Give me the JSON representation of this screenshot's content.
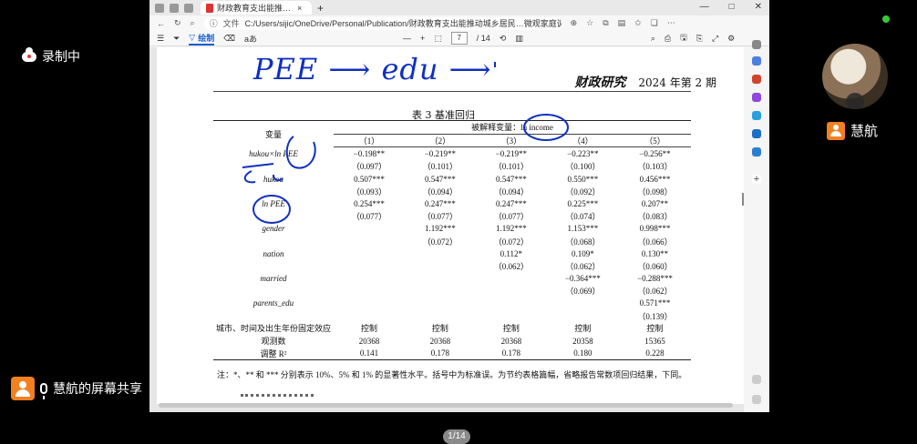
{
  "meeting": {
    "recording_label": "录制中",
    "participant_name": "慧航",
    "share_label": "慧航的屏幕共享"
  },
  "browser": {
    "tab_title": "财政教育支出能推动城乡居民人力资本…",
    "new_tab": "+",
    "address_file_label": "文件",
    "address_path": "C:/Users/sijic/OneDrive/Personal/Publication/财政教育支出能推动城乡居民…微观家庭调查数据的经验证据_贾…",
    "win_buttons": [
      "—",
      "□",
      "✕"
    ]
  },
  "pdf_toolbar": {
    "draw_label": "绘制",
    "read_aloud": "aあ",
    "zoom_minus": "—",
    "zoom_plus": "+",
    "current_page": "7",
    "total_pages": "/ 14",
    "page_badge": "1/14"
  },
  "document": {
    "handwriting": "PEE ⟶ edu ⟶",
    "journal_name": "财政研究",
    "journal_issue": "2024 年第 2 期",
    "table_title": "表 3   基准回归",
    "header_var": "变量",
    "header_dep": "被解释变量：ln income",
    "columns": [
      "（1）",
      "（2）",
      "（3）",
      "（4）",
      "（5）"
    ],
    "rows": [
      {
        "var": "hukou×ln PEE",
        "coef": [
          "−0.198**",
          "−0.219**",
          "−0.219**",
          "−0.223**",
          "−0.256**"
        ],
        "se": [
          "（0.097）",
          "（0.101）",
          "（0.101）",
          "（0.100）",
          "（0.103）"
        ]
      },
      {
        "var": "hukou",
        "coef": [
          "0.507***",
          "0.547***",
          "0.547***",
          "0.550***",
          "0.456***"
        ],
        "se": [
          "（0.093）",
          "（0.094）",
          "（0.094）",
          "（0.092）",
          "（0.098）"
        ]
      },
      {
        "var": "ln PEE",
        "coef": [
          "0.254***",
          "0.247***",
          "0.247***",
          "0.225***",
          "0.207**"
        ],
        "se": [
          "（0.077）",
          "（0.077）",
          "（0.077）",
          "（0.074）",
          "（0.083）"
        ]
      },
      {
        "var": "gender",
        "coef": [
          "",
          "1.192***",
          "1.192***",
          "1.153***",
          "0.998***"
        ],
        "se": [
          "",
          "（0.072）",
          "（0.072）",
          "（0.068）",
          "（0.066）"
        ]
      },
      {
        "var": "nation",
        "coef": [
          "",
          "",
          "0.112*",
          "0.109*",
          "0.130**"
        ],
        "se": [
          "",
          "",
          "（0.062）",
          "（0.062）",
          "（0.060）"
        ]
      },
      {
        "var": "married",
        "coef": [
          "",
          "",
          "",
          "−0.364***",
          "−0.288***"
        ],
        "se": [
          "",
          "",
          "",
          "（0.069）",
          "（0.062）"
        ]
      },
      {
        "var": "parents_edu",
        "coef": [
          "",
          "",
          "",
          "",
          "0.571***"
        ],
        "se": [
          "",
          "",
          "",
          "",
          "（0.139）"
        ]
      }
    ],
    "fe_label": "城市、时间及出生年份固定效应",
    "fe_values": [
      "控制",
      "控制",
      "控制",
      "控制",
      "控制"
    ],
    "obs_label": "观测数",
    "obs_values": [
      "20368",
      "20368",
      "20368",
      "20358",
      "15365"
    ],
    "r2_label": "调整 R²",
    "r2_values": [
      "0.141",
      "0.178",
      "0.178",
      "0.180",
      "0.228"
    ],
    "note": "注：*、** 和 *** 分别表示 10%、5% 和 1% 的显著性水平。括号中为标准误。为节约表格篇幅，省略报告常数项回归结果，下同。"
  },
  "colors": {
    "ink": "#1030c0",
    "accent": "#1a5fd0",
    "avatar": "#f08020"
  }
}
